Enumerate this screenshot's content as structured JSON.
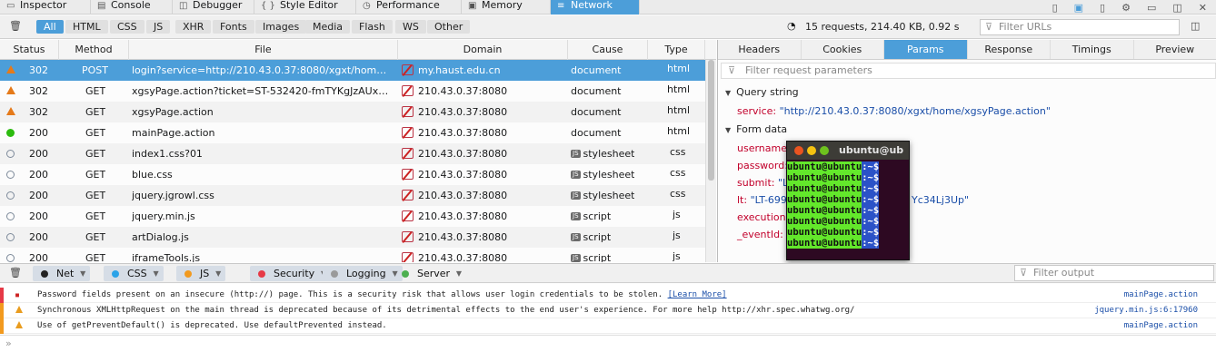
{
  "toolbar": {
    "tabs": [
      {
        "label": "Inspector",
        "icon": "inspector-icon"
      },
      {
        "label": "Console",
        "icon": "console-icon"
      },
      {
        "label": "Debugger",
        "icon": "debugger-icon"
      },
      {
        "label": "Style Editor",
        "icon": "style-editor-icon"
      },
      {
        "label": "Performance",
        "icon": "performance-icon"
      },
      {
        "label": "Memory",
        "icon": "memory-icon"
      },
      {
        "label": "Network",
        "icon": "network-icon"
      }
    ]
  },
  "filters": {
    "types": [
      "All",
      "HTML",
      "CSS",
      "JS",
      "XHR",
      "Fonts",
      "Images",
      "Media",
      "Flash",
      "WS",
      "Other"
    ],
    "summary": "15 requests, 214.40 KB, 0.92 s",
    "filter_urls_placeholder": "Filter URLs"
  },
  "table": {
    "headers": [
      "Status",
      "Method",
      "File",
      "Domain",
      "Cause",
      "Type"
    ],
    "rows": [
      {
        "status": "302",
        "method": "POST",
        "file": "login?service=http://210.43.0.37:8080/xgxt/home/xgsyPage.action",
        "domain": "my.haust.edu.cn",
        "cause": "document",
        "type": "html"
      },
      {
        "status": "302",
        "method": "GET",
        "file": "xgsyPage.action?ticket=ST-532420-fmTYKgJzAUxBaRsH...",
        "domain": "210.43.0.37:8080",
        "cause": "document",
        "type": "html"
      },
      {
        "status": "302",
        "method": "GET",
        "file": "xgsyPage.action",
        "domain": "210.43.0.37:8080",
        "cause": "document",
        "type": "html"
      },
      {
        "status": "200",
        "method": "GET",
        "file": "mainPage.action",
        "domain": "210.43.0.37:8080",
        "cause": "document",
        "type": "html"
      },
      {
        "status": "200",
        "method": "GET",
        "file": "index1.css?01",
        "domain": "210.43.0.37:8080",
        "cause": "stylesheet",
        "type": "css"
      },
      {
        "status": "200",
        "method": "GET",
        "file": "blue.css",
        "domain": "210.43.0.37:8080",
        "cause": "stylesheet",
        "type": "css"
      },
      {
        "status": "200",
        "method": "GET",
        "file": "jquery.jgrowl.css",
        "domain": "210.43.0.37:8080",
        "cause": "stylesheet",
        "type": "css"
      },
      {
        "status": "200",
        "method": "GET",
        "file": "jquery.min.js",
        "domain": "210.43.0.37:8080",
        "cause": "script",
        "type": "js"
      },
      {
        "status": "200",
        "method": "GET",
        "file": "artDialog.js",
        "domain": "210.43.0.37:8080",
        "cause": "script",
        "type": "js"
      },
      {
        "status": "200",
        "method": "GET",
        "file": "iframeTools.js",
        "domain": "210.43.0.37:8080",
        "cause": "script",
        "type": "js"
      }
    ],
    "js_badge": "JS"
  },
  "details": {
    "tabs": [
      "Headers",
      "Cookies",
      "Params",
      "Response",
      "Timings",
      "Preview"
    ],
    "filter_params_placeholder": "Filter request parameters",
    "query_string_title": "Query string",
    "query": [
      {
        "key": "service",
        "value": "\"http://210.43.0.37:8080/xgxt/home/xgsyPage.action\""
      }
    ],
    "form_data_title": "Form data",
    "form": [
      {
        "key": "username",
        "value": ""
      },
      {
        "key": "password",
        "value": ""
      },
      {
        "key": "submit",
        "value": "\"LO"
      },
      {
        "key": "lt",
        "value": "\"LT-6990"
      },
      {
        "key": "execution",
        "value": ""
      },
      {
        "key": "_eventId",
        "value": "\""
      }
    ],
    "lt_tail": "Yc34Lj3Up\""
  },
  "terminal": {
    "title": "ubuntu@ub",
    "user": "ubuntu@ubuntu",
    "path": ":~$",
    "line_count": 8
  },
  "console": {
    "filters": [
      {
        "label": "Net",
        "color": "#222222"
      },
      {
        "label": "CSS",
        "color": "#2ba3e8"
      },
      {
        "label": "JS",
        "color": "#f29a1f"
      },
      {
        "label": "Security",
        "color": "#e63946"
      },
      {
        "label": "Logging",
        "color": "#9a9a9a"
      },
      {
        "label": "Server",
        "color": "#4caf50"
      }
    ],
    "filter_output_placeholder": "Filter output",
    "messages": [
      {
        "text": "Password fields present on an insecure (http://) page. This is a security risk that allows user login credentials to be stolen.",
        "link": "[Learn More]",
        "source": "mainPage.action",
        "gutter": "#e63946"
      },
      {
        "text": "Synchronous XMLHttpRequest on the main thread is deprecated because of its detrimental effects to the end user's experience. For more help http://xhr.spec.whatwg.org/",
        "link": "",
        "source": "jquery.min.js:6:17960",
        "gutter": "#f29a1f"
      },
      {
        "text": "Use of getPreventDefault() is deprecated. Use defaultPrevented instead.",
        "link": "",
        "source": "mainPage.action",
        "gutter": "#f29a1f"
      }
    ],
    "prompt": "»"
  }
}
